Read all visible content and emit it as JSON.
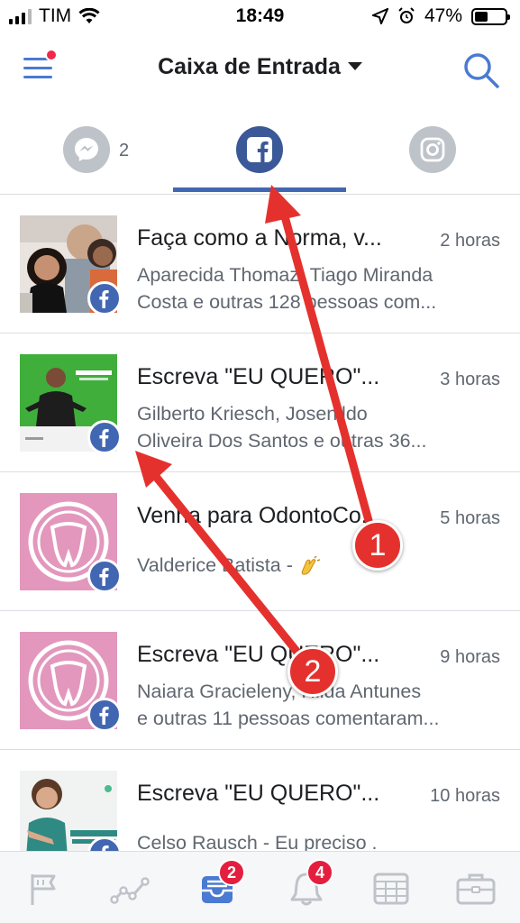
{
  "status_bar": {
    "carrier": "TIM",
    "time": "18:49",
    "battery": "47%"
  },
  "header": {
    "title": "Caixa de Entrada",
    "menu_icon": "hamburger-menu-icon",
    "search_icon": "search-icon"
  },
  "tabs": [
    {
      "name": "messenger",
      "icon": "messenger-icon",
      "count": "2"
    },
    {
      "name": "facebook",
      "icon": "facebook-icon",
      "active": true
    },
    {
      "name": "instagram",
      "icon": "instagram-icon"
    }
  ],
  "items": [
    {
      "title": "Faça como a Norma, v...",
      "time": "2 horas",
      "line1": "Aparecida Thomaz, Tiago Miranda",
      "line2": "Costa e outras 128 pessoas com..."
    },
    {
      "title": "Escreva \"EU QUERO\"...",
      "time": "3 horas",
      "line1": "Gilberto Kriesch, Josenildo",
      "line2": "Oliveira Dos Santos e outras 36..."
    },
    {
      "title": "Venha para OdontoCo...",
      "time": "5 horas",
      "line1": "Valderice Batista - ",
      "line2": ""
    },
    {
      "title": "Escreva \"EU QUERO\"...",
      "time": "9 horas",
      "line1": "Naiara Gracieleny, Hilda Antunes",
      "line2": "e outras 11 pessoas comentaram..."
    },
    {
      "title": "Escreva \"EU QUERO\"...",
      "time": "10 horas",
      "line1": "Celso Rausch - Eu preciso .",
      "line2": ""
    }
  ],
  "bottom_nav": [
    {
      "icon": "flag-icon"
    },
    {
      "icon": "insights-icon"
    },
    {
      "icon": "inbox-icon",
      "badge": "2",
      "active": true
    },
    {
      "icon": "bell-icon",
      "badge": "4"
    },
    {
      "icon": "calendar-icon"
    },
    {
      "icon": "briefcase-icon"
    }
  ],
  "annotations": {
    "marker_1": "1",
    "marker_2": "2",
    "color": "#e5312d"
  },
  "colors": {
    "facebook_blue": "#4267b2",
    "active_blue": "#3b5998",
    "gray_icon": "#bec3c9",
    "badge_red": "#e41e3f"
  }
}
